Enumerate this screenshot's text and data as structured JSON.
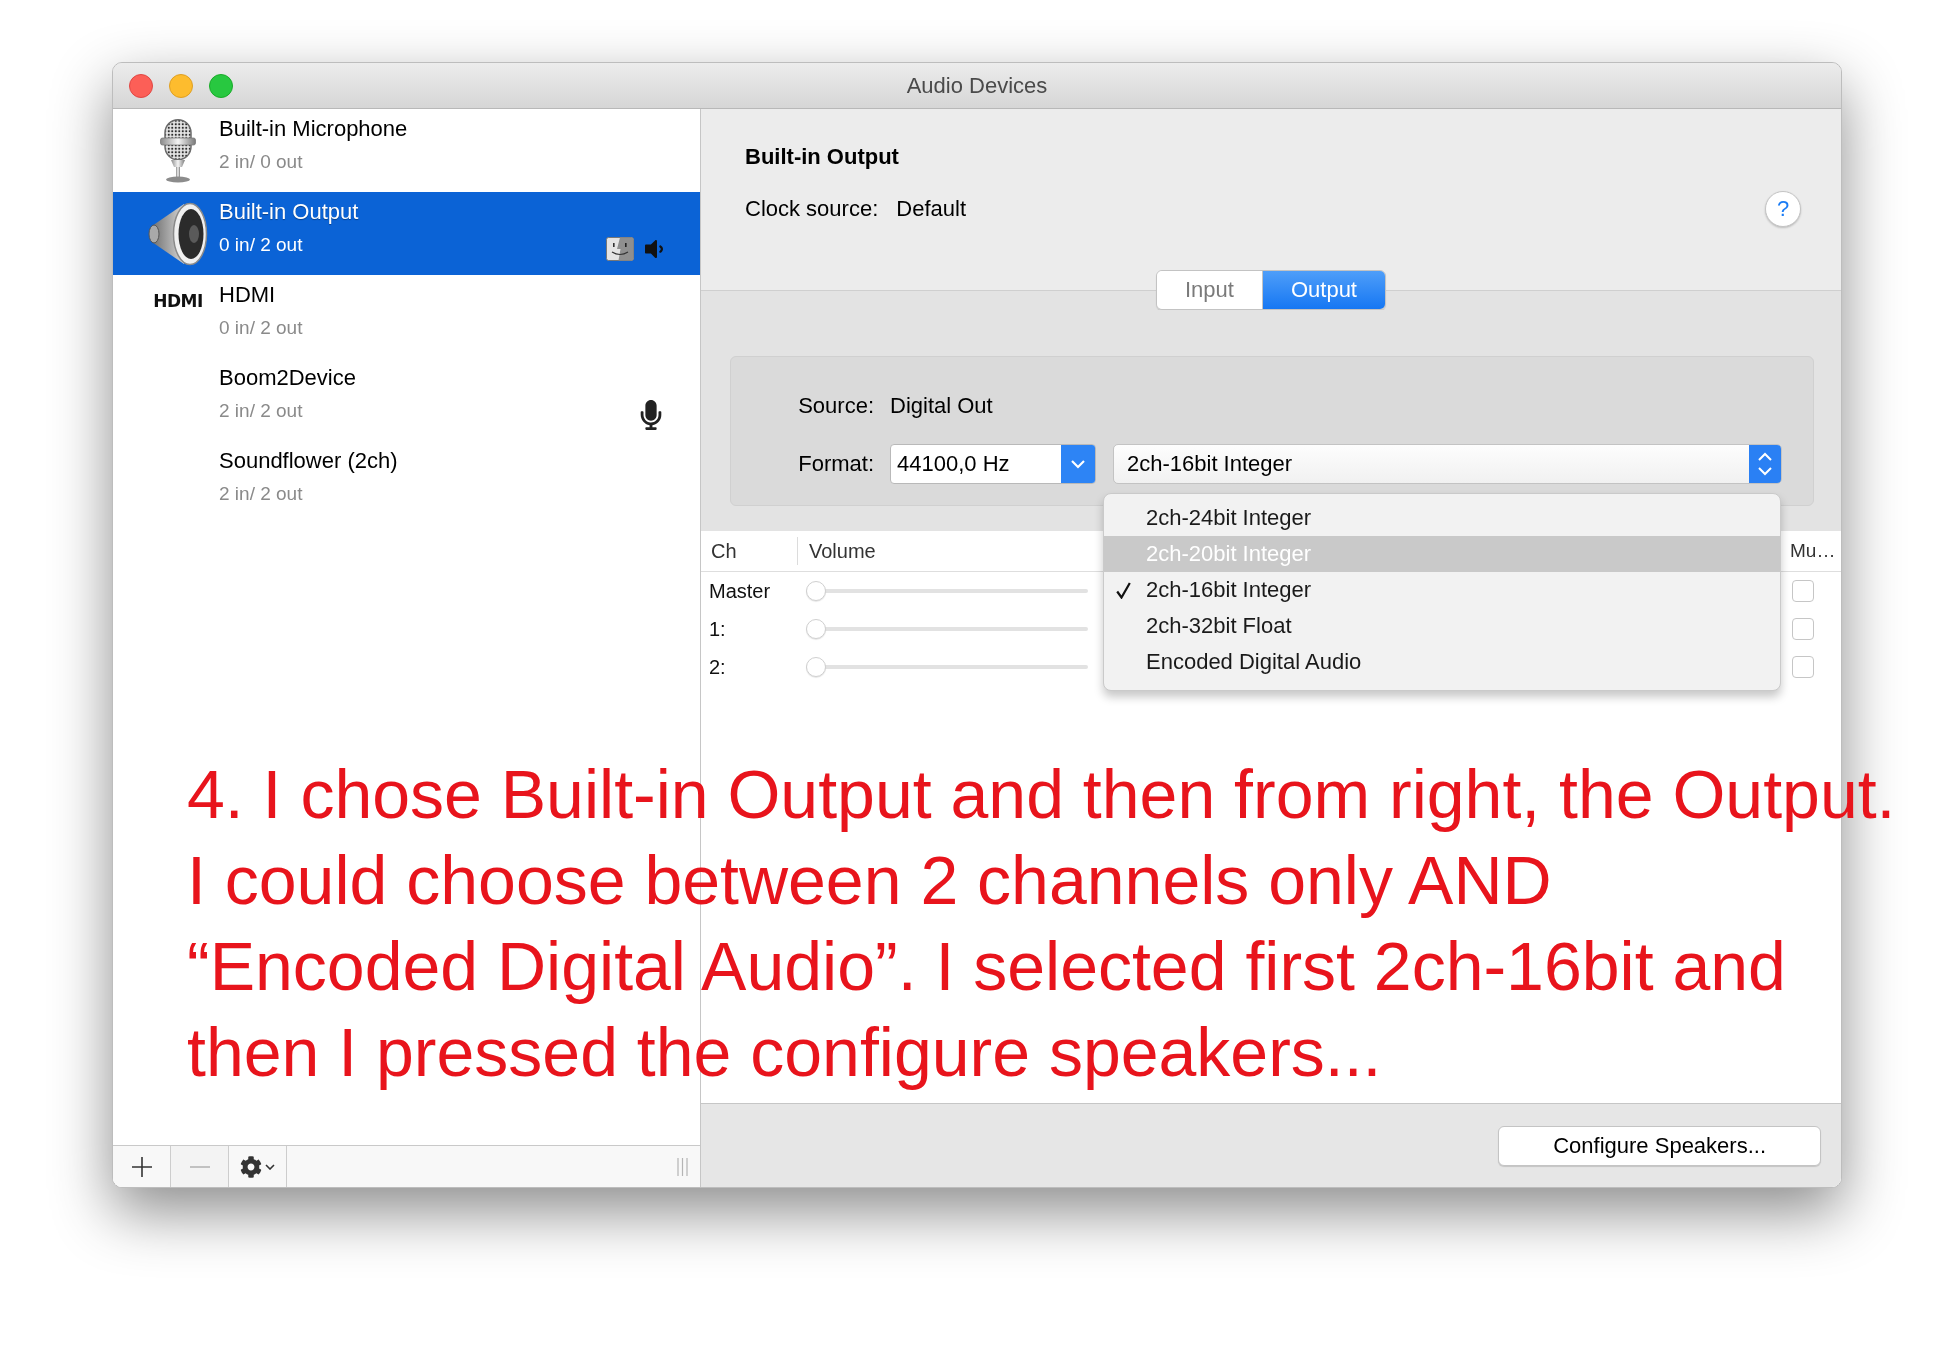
{
  "window": {
    "title": "Audio Devices"
  },
  "devices": [
    {
      "kind": "microphone",
      "name": "Built-in Microphone",
      "io": "2 in/ 0 out",
      "selected": false,
      "system_sounds_output": false,
      "default_output": false,
      "default_input": false
    },
    {
      "kind": "speaker",
      "name": "Built-in Output",
      "io": "0 in/ 2 out",
      "selected": true,
      "system_sounds_output": true,
      "default_output": true,
      "default_input": false
    },
    {
      "kind": "hdmi",
      "logo": "HDMI",
      "name": "HDMI",
      "io": "0 in/ 2 out",
      "selected": false,
      "system_sounds_output": false,
      "default_output": false,
      "default_input": false
    },
    {
      "kind": "plain",
      "name": "Boom2Device",
      "io": "2 in/ 2 out",
      "selected": false,
      "system_sounds_output": false,
      "default_output": false,
      "default_input": true
    },
    {
      "kind": "plain",
      "name": "Soundflower (2ch)",
      "io": "2 in/ 2 out",
      "selected": false,
      "system_sounds_output": false,
      "default_output": false,
      "default_input": false
    }
  ],
  "sidebar_toolbar": [
    {
      "kind": "add",
      "disabled": false
    },
    {
      "kind": "remove",
      "disabled": true
    },
    {
      "kind": "action",
      "disabled": false
    }
  ],
  "device_detail": {
    "title": "Built-in Output",
    "clock_source_label": "Clock source:",
    "clock_source": "Default",
    "help": "?"
  },
  "tabs": [
    {
      "label": "Input",
      "selected": false
    },
    {
      "label": "Output",
      "selected": true
    }
  ],
  "stream": {
    "source_label": "Source:",
    "source": "Digital Out",
    "format_label": "Format:",
    "sample_rate": "44100,0 Hz",
    "format": "2ch-16bit Integer"
  },
  "format_menu": {
    "open": true,
    "items": [
      {
        "label": "2ch-24bit Integer",
        "checked": false,
        "selected": false
      },
      {
        "label": "2ch-20bit Integer",
        "checked": false,
        "selected": true
      },
      {
        "label": "2ch-16bit Integer",
        "checked": true,
        "selected": false
      },
      {
        "label": "2ch-32bit Float",
        "checked": false,
        "selected": false
      },
      {
        "label": "Encoded Digital Audio",
        "checked": false,
        "selected": false
      }
    ]
  },
  "channels": {
    "columns": [
      "Ch",
      "Volume",
      "Mu…"
    ],
    "rows": [
      {
        "name": "Master",
        "level": 0,
        "muted": false
      },
      {
        "name": "1:",
        "level": 0,
        "muted": false
      },
      {
        "name": "2:",
        "level": 0,
        "muted": false
      }
    ]
  },
  "configure_button": "Configure Speakers...",
  "annotation": {
    "lines": [
      "4. I chose Built-in Output and then from right, the Output.",
      "I could choose between 2 channels only AND",
      "“Encoded Digital Audio”. I selected first 2ch-16bit and",
      "then I pressed the configure speakers..."
    ]
  }
}
